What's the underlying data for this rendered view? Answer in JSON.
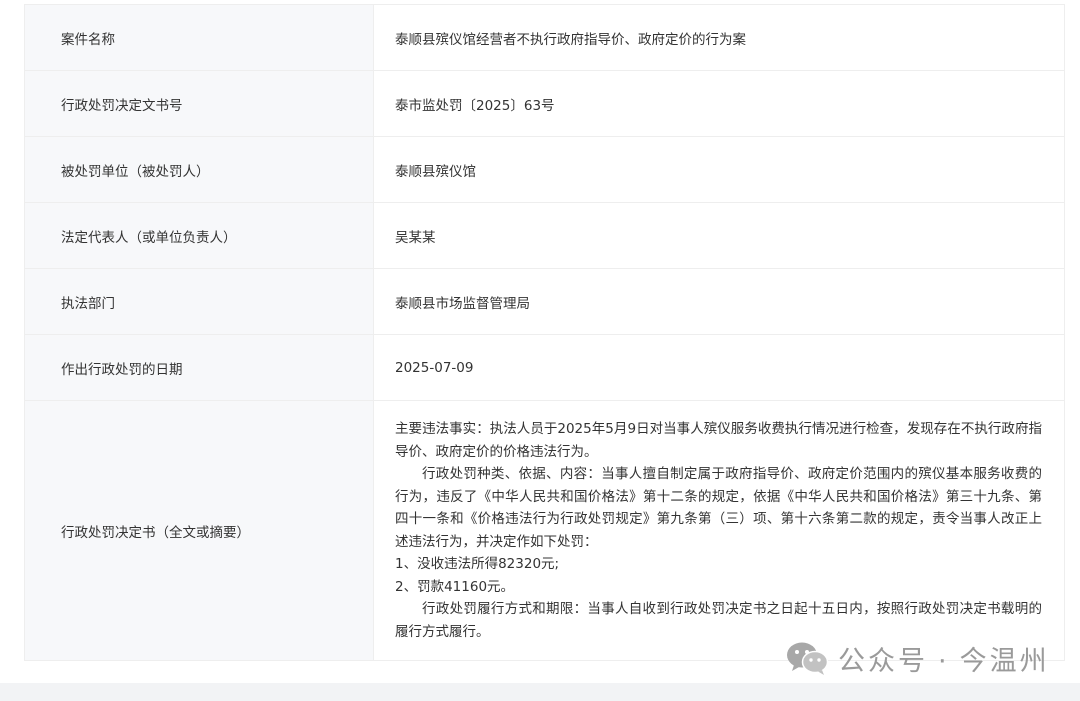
{
  "record": {
    "rows": [
      {
        "label": "案件名称",
        "value": "泰顺县殡仪馆经营者不执行政府指导价、政府定价的行为案"
      },
      {
        "label": "行政处罚决定文书号",
        "value": "泰市监处罚〔2025〕63号"
      },
      {
        "label": "被处罚单位（被处罚人）",
        "value": "泰顺县殡仪馆"
      },
      {
        "label": "法定代表人（或单位负责人）",
        "value": "吴某某"
      },
      {
        "label": "执法部门",
        "value": "泰顺县市场监督管理局"
      },
      {
        "label": "作出行政处罚的日期",
        "value": "2025-07-09"
      }
    ],
    "decision": {
      "label": "行政处罚决定书（全文或摘要）",
      "paragraphs": [
        "主要违法事实：执法人员于2025年5月9日对当事人殡仪服务收费执行情况进行检查，发现存在不执行政府指导价、政府定价的价格违法行为。",
        "行政处罚种类、依据、内容：当事人擅自制定属于政府指导价、政府定价范围内的殡仪基本服务收费的行为，违反了《中华人民共和国价格法》第十二条的规定，依据《中华人民共和国价格法》第三十九条、第四十一条和《价格违法行为行政处罚规定》第九条第（三）项、第十六条第二款的规定，责令当事人改正上述违法行为，并决定作如下处罚：",
        "1、没收违法所得82320元;",
        "2、罚款41160元。",
        "行政处罚履行方式和期限：当事人自收到行政处罚决定书之日起十五日内，按照行政处罚决定书载明的履行方式履行。"
      ]
    }
  },
  "watermark": {
    "icon": "wechat-icon",
    "account_prefix": "公众号",
    "separator": "·",
    "account_name": "今温州"
  }
}
